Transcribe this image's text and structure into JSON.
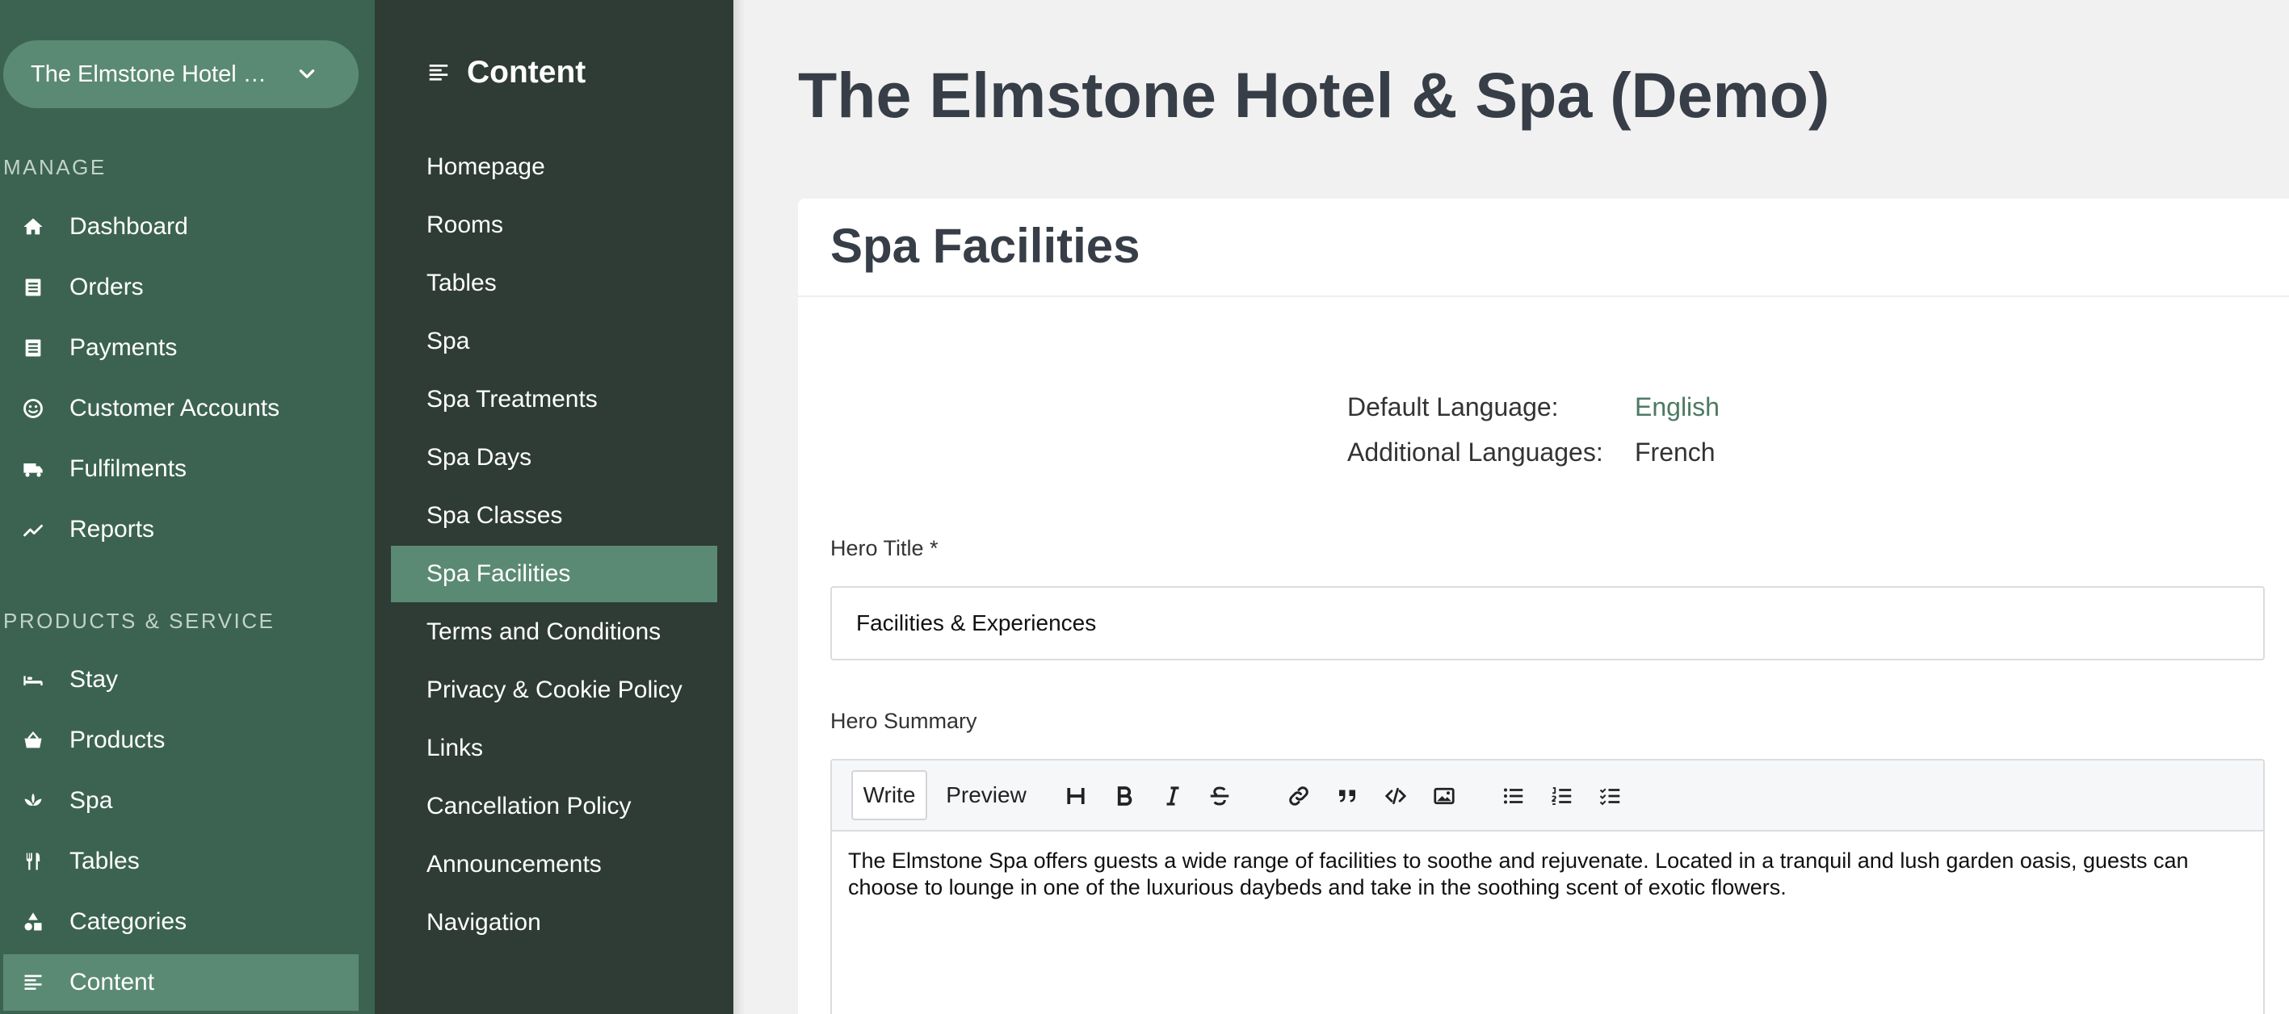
{
  "sidebar": {
    "hotel_name": "The Elmstone Hotel & Spa (Demo)",
    "sections": [
      {
        "label": "MANAGE",
        "items": [
          {
            "label": "Dashboard",
            "icon": "home-icon"
          },
          {
            "label": "Orders",
            "icon": "list-icon"
          },
          {
            "label": "Payments",
            "icon": "list-icon"
          },
          {
            "label": "Customer Accounts",
            "icon": "smile-icon"
          },
          {
            "label": "Fulfilments",
            "icon": "truck-icon"
          },
          {
            "label": "Reports",
            "icon": "chart-line-icon"
          }
        ]
      },
      {
        "label": "PRODUCTS & SERVICE",
        "items": [
          {
            "label": "Stay",
            "icon": "bed-icon"
          },
          {
            "label": "Products",
            "icon": "basket-icon"
          },
          {
            "label": "Spa",
            "icon": "lotus-icon"
          },
          {
            "label": "Tables",
            "icon": "utensils-icon"
          },
          {
            "label": "Categories",
            "icon": "shapes-icon"
          },
          {
            "label": "Content",
            "icon": "align-left-icon",
            "active": true
          }
        ]
      }
    ]
  },
  "subnav": {
    "title": "Content",
    "items": [
      {
        "label": "Homepage"
      },
      {
        "label": "Rooms"
      },
      {
        "label": "Tables"
      },
      {
        "label": "Spa"
      },
      {
        "label": "Spa Treatments"
      },
      {
        "label": "Spa Days"
      },
      {
        "label": "Spa Classes"
      },
      {
        "label": "Spa Facilities",
        "active": true
      },
      {
        "label": "Terms and Conditions"
      },
      {
        "label": "Privacy & Cookie Policy"
      },
      {
        "label": "Links"
      },
      {
        "label": "Cancellation Policy"
      },
      {
        "label": "Announcements"
      },
      {
        "label": "Navigation"
      }
    ]
  },
  "main": {
    "page_title": "The Elmstone Hotel & Spa (Demo)",
    "card_title": "Spa Facilities",
    "languages": {
      "default_label": "Default Language:",
      "default_value": "English",
      "additional_label": "Additional Languages:",
      "additional_value": "French"
    },
    "hero_title": {
      "label": "Hero Title *",
      "value": "Facilities & Experiences"
    },
    "hero_summary": {
      "label": "Hero Summary",
      "tabs": {
        "write": "Write",
        "preview": "Preview"
      },
      "tools": [
        "heading-icon",
        "bold-icon",
        "italic-icon",
        "strikethrough-icon",
        "link-icon",
        "quote-icon",
        "code-icon",
        "image-icon",
        "bulleted-list-icon",
        "numbered-list-icon",
        "task-list-icon"
      ],
      "text": "The Elmstone Spa offers guests a wide range of facilities to soothe and rejuvenate. Located in a tranquil and lush garden oasis, guests can choose to lounge in one of the luxurious daybeds and take in the soothing scent of exotic flowers."
    }
  },
  "colors": {
    "sidebar_bg": "#3c6352",
    "subnav_bg": "#2e3c35",
    "active_bg": "#5b8a74",
    "accent_link": "#4c7a63",
    "title_text": "#373e47"
  }
}
